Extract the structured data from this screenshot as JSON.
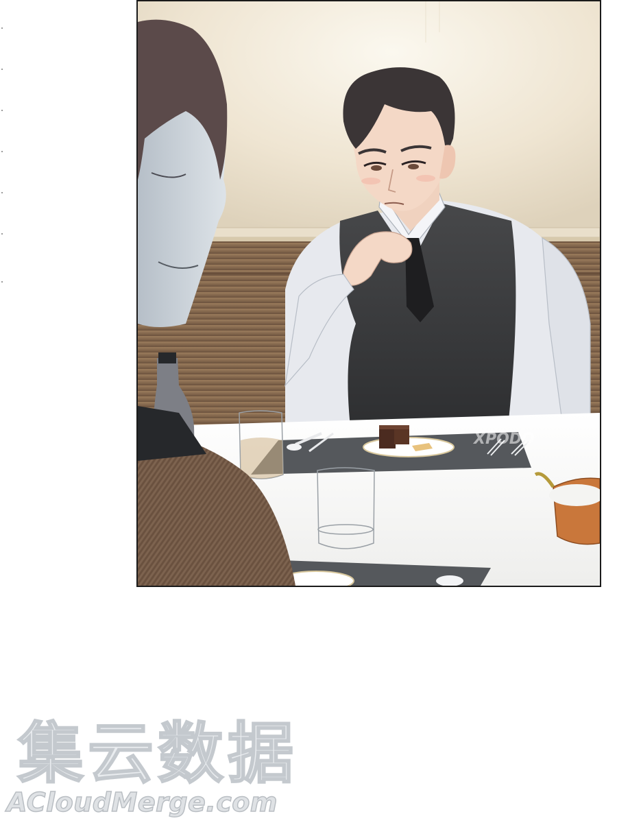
{
  "scene": {
    "description_alt": "",
    "panel_watermark": "XPODO",
    "colors": {
      "wall": "#efe6d4",
      "wainscot": "#8a6c4e",
      "table": "#fbfbfa",
      "placemat": "#55585c",
      "vest": "#3a3b3d",
      "shirt": "#e7e9ee",
      "hair": "#3b3536",
      "chair": "#7a2a26"
    }
  },
  "watermark": {
    "chinese": "集云数据",
    "english": "ACloudMerge.com"
  }
}
